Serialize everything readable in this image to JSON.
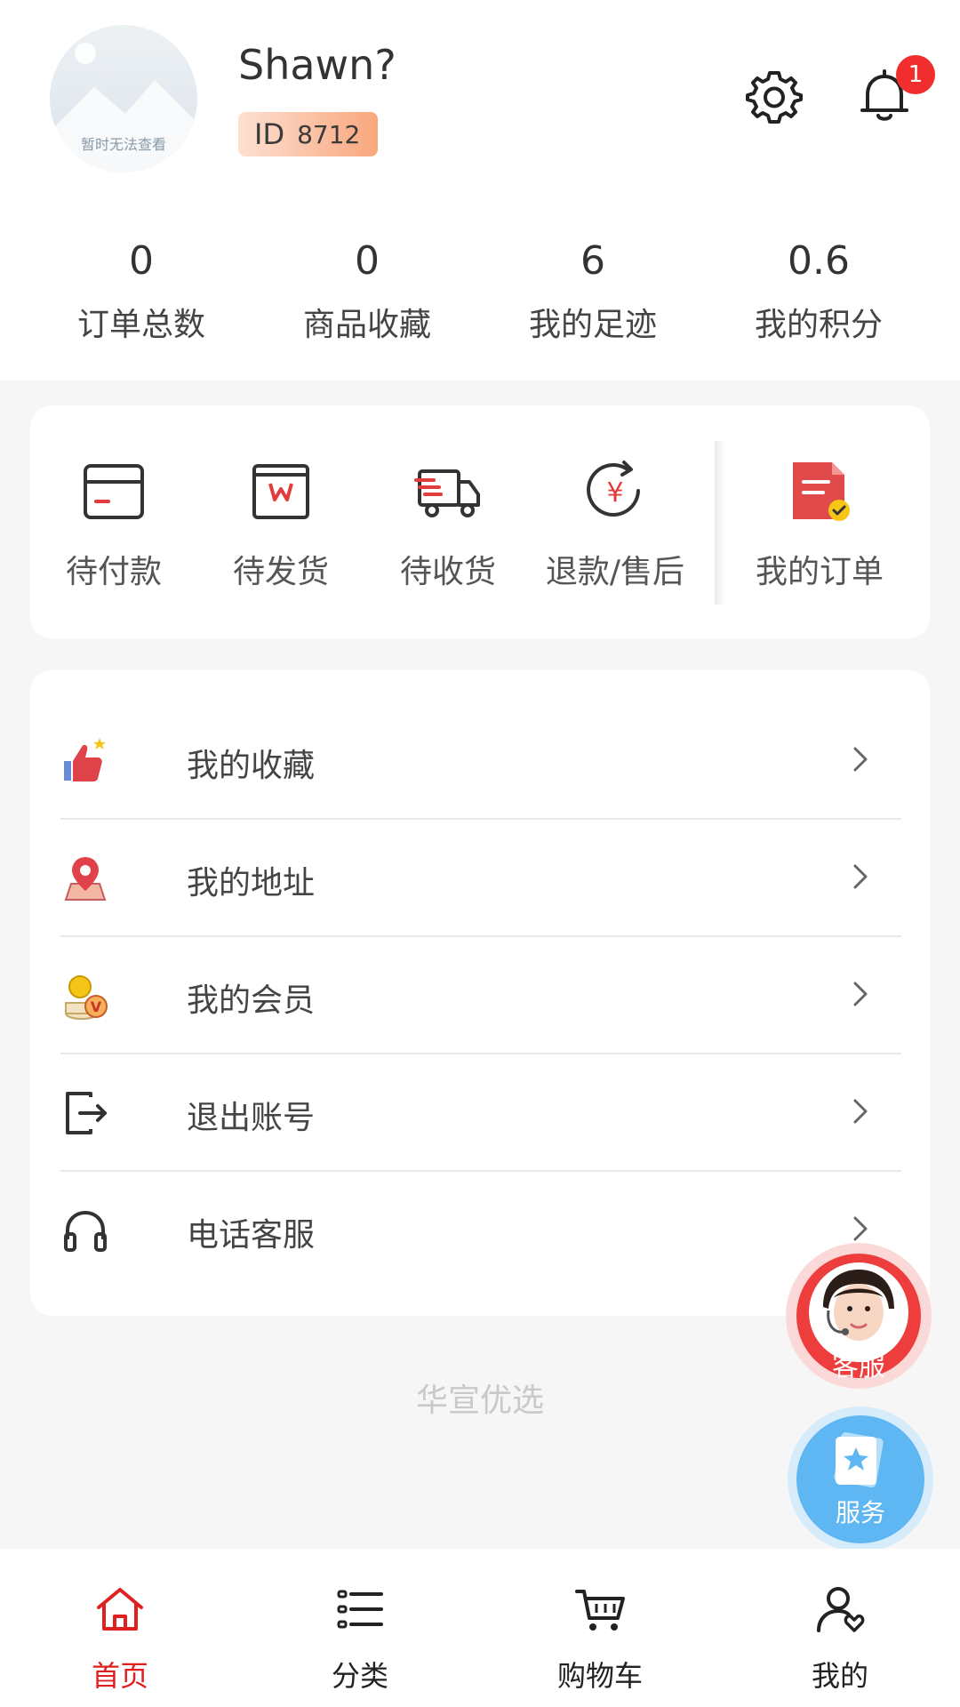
{
  "profile": {
    "avatar_caption": "暂时无法查看",
    "username": "Shawn?",
    "id_label": "ID",
    "id_value": "8712",
    "notification_count": "1"
  },
  "stats": [
    {
      "value": "0",
      "label": "订单总数"
    },
    {
      "value": "0",
      "label": "商品收藏"
    },
    {
      "value": "6",
      "label": "我的足迹"
    },
    {
      "value": "0.6",
      "label": "我的积分"
    }
  ],
  "orders": {
    "items": [
      {
        "label": "待付款",
        "icon": "wallet-icon"
      },
      {
        "label": "待发货",
        "icon": "package-icon"
      },
      {
        "label": "待收货",
        "icon": "truck-icon"
      },
      {
        "label": "退款/售后",
        "icon": "refund-icon"
      }
    ],
    "my_orders": {
      "label": "我的订单",
      "icon": "order-document-icon"
    }
  },
  "menu": [
    {
      "label": "我的收藏",
      "icon": "thumbs-up-star-icon"
    },
    {
      "label": "我的地址",
      "icon": "location-pin-icon"
    },
    {
      "label": "我的会员",
      "icon": "member-coins-icon"
    },
    {
      "label": "退出账号",
      "icon": "logout-icon"
    },
    {
      "label": "电话客服",
      "icon": "headset-icon"
    }
  ],
  "footer_brand": "华宣优选",
  "floating": {
    "customer_service_label": "客服",
    "service_label": "服务"
  },
  "tabbar": [
    {
      "label": "首页",
      "icon": "home-icon",
      "active": true
    },
    {
      "label": "分类",
      "icon": "list-icon",
      "active": false
    },
    {
      "label": "购物车",
      "icon": "cart-icon",
      "active": false
    },
    {
      "label": "我的",
      "icon": "user-icon",
      "active": false
    }
  ],
  "colors": {
    "accent": "#e02020",
    "badge": "#f12d2d",
    "id_badge_start": "#fde0d2",
    "id_badge_end": "#f9a77c",
    "service_blue": "#5eb6f2"
  }
}
